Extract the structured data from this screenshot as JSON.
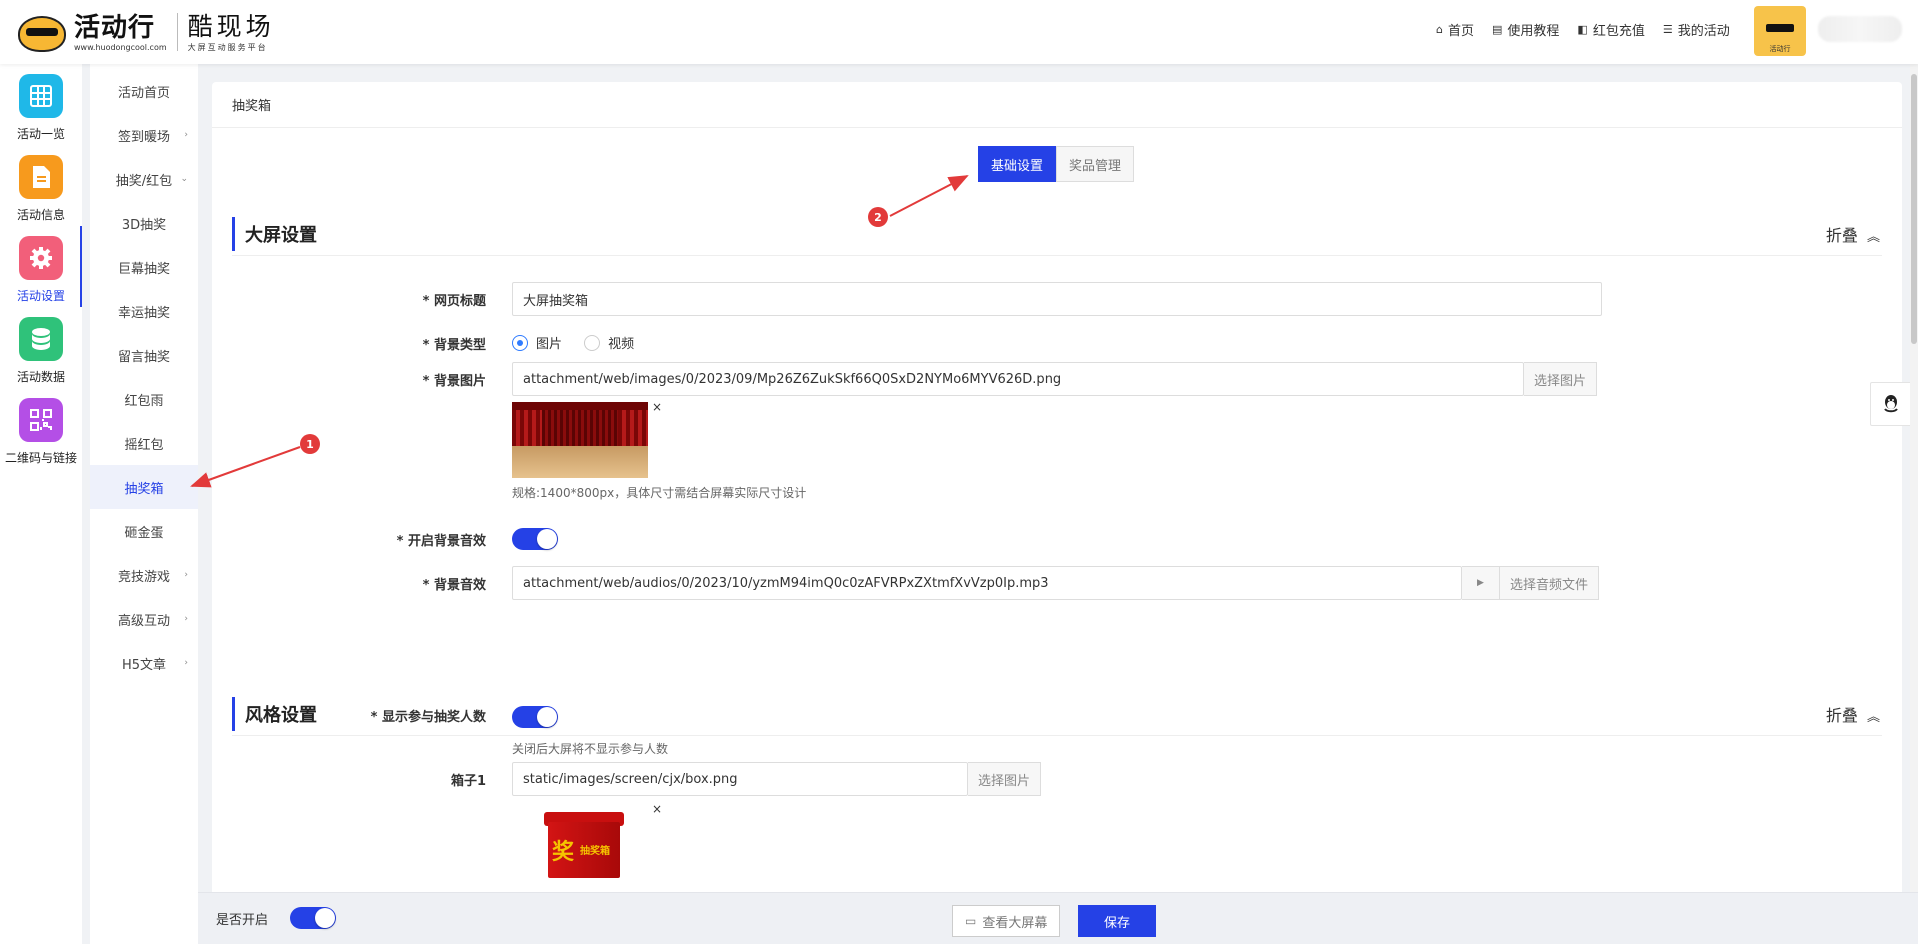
{
  "header": {
    "brand_name": "活动行",
    "brand_url": "www.huodongcool.com",
    "brand_sub_name": "酷现场",
    "brand_sub_tagline": "大屏互动服务平台",
    "nav": [
      {
        "label": "首页",
        "icon": "home-icon"
      },
      {
        "label": "使用教程",
        "icon": "book-icon"
      },
      {
        "label": "红包充值",
        "icon": "wallet-icon"
      },
      {
        "label": "我的活动",
        "icon": "list-icon"
      }
    ],
    "avatar_caption": "活动行"
  },
  "iconbar": [
    {
      "label": "活动一览",
      "icon": "grid-icon",
      "color": "#1fb8e8"
    },
    {
      "label": "活动信息",
      "icon": "document-icon",
      "color": "#f79a1d"
    },
    {
      "label": "活动设置",
      "icon": "gear-icon",
      "color": "#f25f7a",
      "active": true
    },
    {
      "label": "活动数据",
      "icon": "database-icon",
      "color": "#2fc27a"
    },
    {
      "label": "二维码与链接",
      "icon": "qrcode-icon",
      "color": "#b44fe6"
    }
  ],
  "submenu": [
    {
      "label": "活动首页",
      "arrow": ""
    },
    {
      "label": "签到暖场",
      "arrow": "›"
    },
    {
      "label": "抽奖/红包",
      "arrow": "⌄"
    },
    {
      "label": "3D抽奖",
      "arrow": ""
    },
    {
      "label": "巨幕抽奖",
      "arrow": ""
    },
    {
      "label": "幸运抽奖",
      "arrow": ""
    },
    {
      "label": "留言抽奖",
      "arrow": ""
    },
    {
      "label": "红包雨",
      "arrow": ""
    },
    {
      "label": "摇红包",
      "arrow": ""
    },
    {
      "label": "抽奖箱",
      "arrow": "",
      "active": true
    },
    {
      "label": "砸金蛋",
      "arrow": ""
    },
    {
      "label": "竞技游戏",
      "arrow": "›"
    },
    {
      "label": "高级互动",
      "arrow": "›"
    },
    {
      "label": "H5文章",
      "arrow": "›"
    }
  ],
  "main": {
    "breadcrumb": "抽奖箱",
    "tabs": [
      {
        "label": "基础设置",
        "active": true
      },
      {
        "label": "奖品管理",
        "active": false
      }
    ],
    "section_screen": {
      "title": "大屏设置",
      "fold_label": "折叠"
    },
    "page_title_field": {
      "label": "* 网页标题",
      "value": "大屏抽奖箱"
    },
    "bg_type_field": {
      "label": "* 背景类型",
      "options": [
        "图片",
        "视频"
      ],
      "selected": "图片"
    },
    "bg_image_field": {
      "label": "* 背景图片",
      "value": "attachment/web/images/0/2023/09/Mp26Z6ZukSkf66Q0SxD2NYMo6MYV626D.png",
      "button": "选择图片",
      "remove": "×",
      "hint": "规格:1400*800px，具体尺寸需结合屏幕实际尺寸设计"
    },
    "bg_sound_switch": {
      "label": "* 开启背景音效",
      "on": true
    },
    "bg_sound_field": {
      "label": "* 背景音效",
      "value": "attachment/web/audios/0/2023/10/yzmM94imQ0c0zAFVRPxZXtmfXvVzp0Ip.mp3",
      "play": "▶",
      "button": "选择音频文件"
    },
    "show_count_switch": {
      "label": "* 显示参与抽奖人数",
      "on": true,
      "hint": "关闭后大屏将不显示参与人数"
    },
    "section_style": {
      "title": "风格设置",
      "fold_label": "折叠"
    },
    "box1_field": {
      "label": "箱子1",
      "value": "static/images/screen/cjx/box.png",
      "button": "选择图片",
      "remove": "×",
      "box_char": "奖",
      "box_text": "抽奖箱"
    }
  },
  "footer": {
    "enable_label": "是否开启",
    "enable_on": true,
    "preview_label": "查看大屏幕",
    "save_label": "保存"
  },
  "annotations": [
    "1",
    "2"
  ],
  "colors": {
    "primary": "#2541e6",
    "annotation": "#e23a3a"
  }
}
